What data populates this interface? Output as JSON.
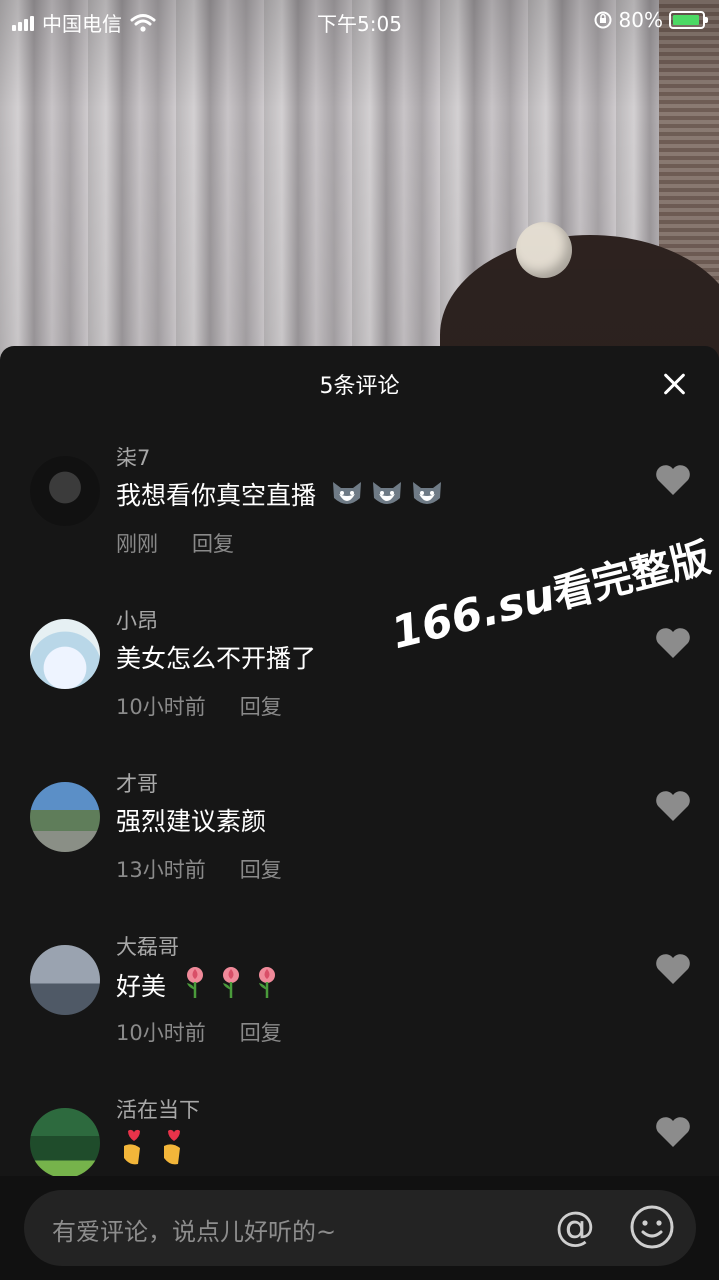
{
  "status_bar": {
    "carrier": "中国电信",
    "time": "下午5:05",
    "battery": "80%"
  },
  "comments_panel": {
    "title": "5条评论"
  },
  "comments": [
    {
      "user": "柒7",
      "text": "我想看你真空直播",
      "time": "刚刚",
      "reply_label": "回复",
      "emojis": [
        "husky-emoji",
        "husky-emoji",
        "husky-emoji"
      ]
    },
    {
      "user": "小昂",
      "text": "美女怎么不开播了",
      "time": "10小时前",
      "reply_label": "回复",
      "emojis": []
    },
    {
      "user": "才哥",
      "text": "强烈建议素颜",
      "time": "13小时前",
      "reply_label": "回复",
      "emojis": []
    },
    {
      "user": "大磊哥",
      "text": "好美",
      "time": "10小时前",
      "reply_label": "回复",
      "emojis": [
        "rose-emoji",
        "rose-emoji",
        "rose-emoji"
      ]
    },
    {
      "user": "活在当下",
      "text": "",
      "time": "",
      "reply_label": "",
      "emojis": [
        "heart-hands-emoji",
        "heart-hands-emoji"
      ]
    }
  ],
  "watermark": {
    "url": "166.su",
    "text": "看完整版"
  },
  "input": {
    "placeholder": "有爱评论，说点儿好听的~",
    "at_symbol": "@"
  },
  "colors": {
    "sheet_bg": "#161616",
    "username": "#a8a8a8",
    "meta": "#8a8a8a",
    "like_icon": "#8c8c8c",
    "battery_fill": "#4cd964"
  }
}
